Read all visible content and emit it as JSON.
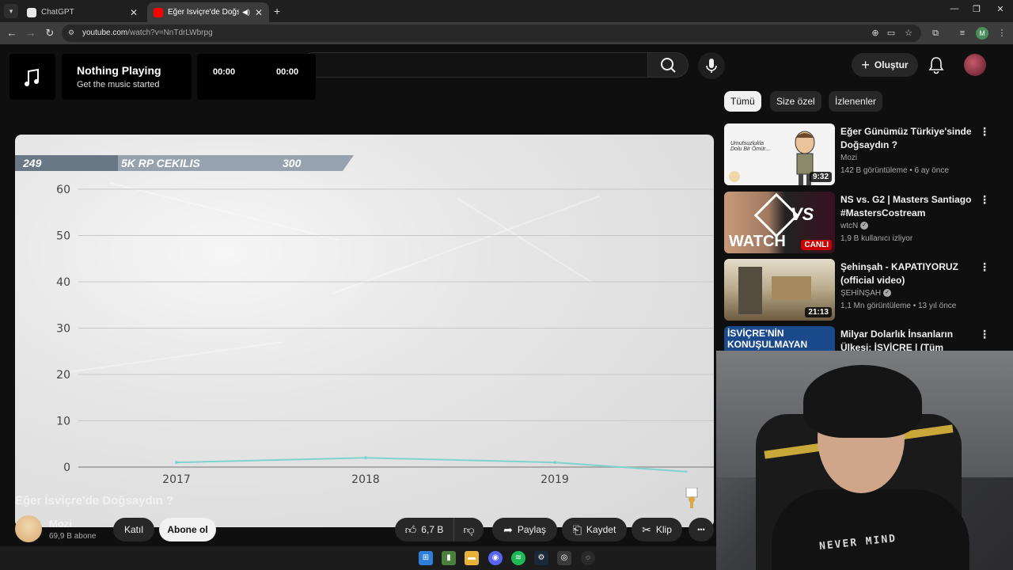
{
  "browser": {
    "tabs": [
      {
        "title": "ChatGPT",
        "active": false
      },
      {
        "title": "Eğer İsviçre'de Doğsaydın ?",
        "active": true
      }
    ],
    "new_tab_label": "+",
    "url_host": "youtube.com",
    "url_path": "/watch?v=NnTdrLWbrpg",
    "profile_initial": "M"
  },
  "topbar": {
    "create_label": "Oluştur"
  },
  "music_widget": {
    "title": "Nothing Playing",
    "subtitle": "Get the music started",
    "elapsed": "00:00",
    "total": "00:00"
  },
  "video": {
    "banner": {
      "left_value": "249",
      "center_text": "5K RP CEKILIS",
      "right_value": "300"
    },
    "title": "Eğer İsviçre'de Doğsaydın ?",
    "channel": "Mozi",
    "subscribers": "69,9 B abone",
    "join_label": "Katıl",
    "subscribe_label": "Abone ol",
    "likes": "6,7 B",
    "share_label": "Paylaş",
    "save_label": "Kaydet",
    "clip_label": "Klip",
    "more_label": "•••"
  },
  "chart_data": {
    "type": "line",
    "x": [
      "2017",
      "2018",
      "2019",
      "2019.7"
    ],
    "series": [
      {
        "values": [
          1,
          2,
          1,
          -1
        ]
      }
    ],
    "y_ticks": [
      "60",
      "50",
      "40",
      "30",
      "20",
      "10",
      "0"
    ],
    "x_ticks": [
      "2017",
      "2018",
      "2019"
    ],
    "ylim": [
      0,
      60
    ],
    "grid": true
  },
  "filters": [
    {
      "label": "Tümü",
      "active": true
    },
    {
      "label": "Size özel",
      "active": false
    },
    {
      "label": "İzlenenler",
      "active": false
    }
  ],
  "related": [
    {
      "title": "Eğer Günümüz Türkiye'sinde Doğsaydın ?",
      "channel": "Mozi",
      "meta": "142 B görüntüleme • 6 ay önce",
      "duration": "9:32",
      "live": false,
      "verified": false,
      "thumb_text": "Umutsuzlukla Dolu Bir Ömür..."
    },
    {
      "title": "NS vs. G2 | Masters Santiago #MastersCostream",
      "channel": "wtcN",
      "meta": "1,9 B kullanıcı izliyor",
      "duration": "CANLI",
      "live": true,
      "verified": true,
      "thumb_text": "WATCH"
    },
    {
      "title": "Şehinşah - KAPATIYORUZ (official video)",
      "channel": "ŞEHİNŞAH",
      "meta": "1,1 Mn görüntüleme • 13 yıl önce",
      "duration": "21:13",
      "live": false,
      "verified": true,
      "thumb_text": ""
    },
    {
      "title": "Milyar Dolarlık İnsanların Ülkesi: İSVİÇRE | (Tüm Gerçekleriyle!)",
      "channel": "",
      "meta": "",
      "duration": "",
      "live": false,
      "verified": false,
      "thumb_text": "İSVİÇRE'NİN KONUŞULMAYAN"
    }
  ],
  "webcam": {
    "shirt_print": "NEVER MIND"
  },
  "colors": {
    "accent": "#ff0000",
    "line": "#7fd3cf",
    "chip_active": "#f1f1f1"
  },
  "icons": [
    "music-note-icon",
    "search-icon",
    "mic-icon",
    "plus-icon",
    "bell-icon",
    "like-icon",
    "dislike-icon",
    "share-icon",
    "save-icon",
    "clip-icon"
  ]
}
